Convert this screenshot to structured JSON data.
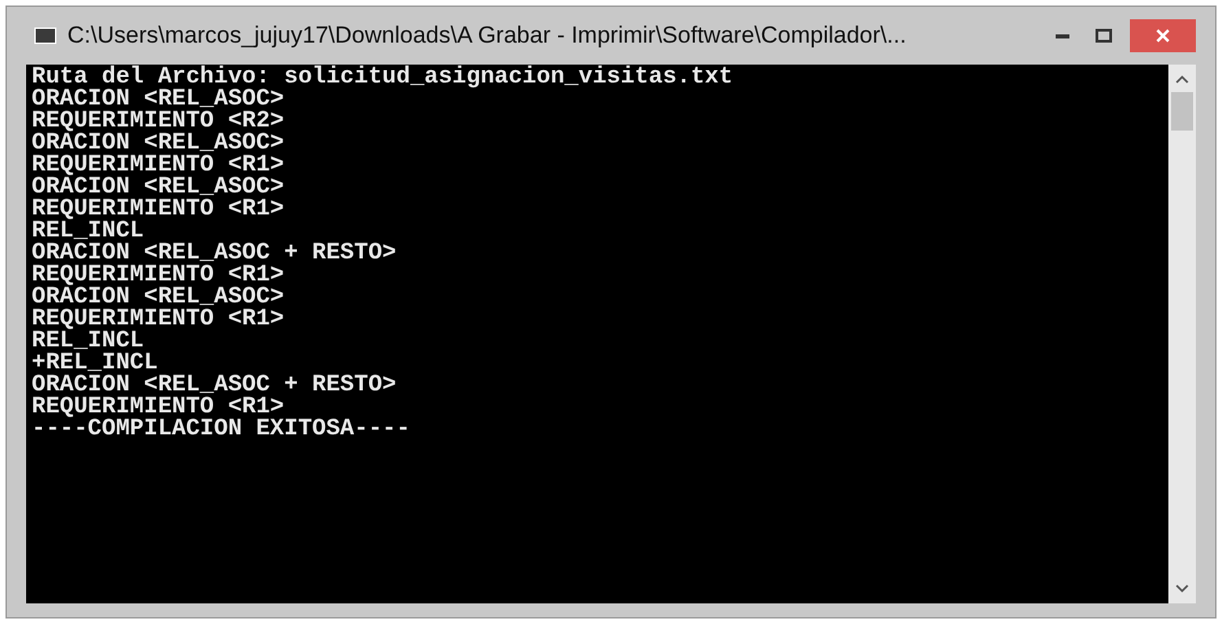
{
  "window": {
    "title": "C:\\Users\\marcos_jujuy17\\Downloads\\A Grabar - Imprimir\\Software\\Compilador\\..."
  },
  "console": {
    "lines": [
      "Ruta del Archivo: solicitud_asignacion_visitas.txt",
      "ORACION <REL_ASOC>",
      "REQUERIMIENTO <R2>",
      "ORACION <REL_ASOC>",
      "REQUERIMIENTO <R1>",
      "ORACION <REL_ASOC>",
      "REQUERIMIENTO <R1>",
      "REL_INCL",
      "ORACION <REL_ASOC + RESTO>",
      "REQUERIMIENTO <R1>",
      "ORACION <REL_ASOC>",
      "REQUERIMIENTO <R1>",
      "REL_INCL",
      "+REL_INCL",
      "ORACION <REL_ASOC + RESTO>",
      "REQUERIMIENTO <R1>",
      "----COMPILACION EXITOSA----"
    ]
  }
}
